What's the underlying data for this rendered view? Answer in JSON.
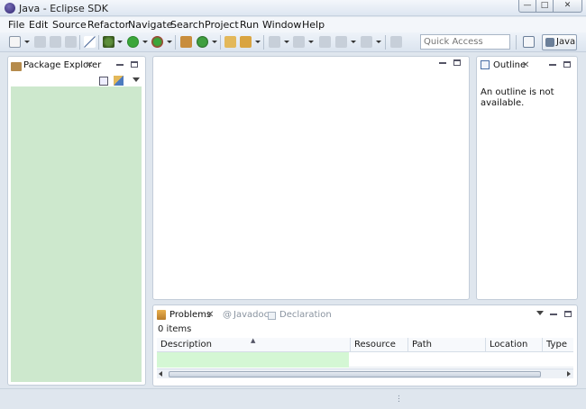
{
  "window": {
    "title": "Java - Eclipse SDK"
  },
  "menu": [
    "File",
    "Edit",
    "Source",
    "Refactor",
    "Navigate",
    "Search",
    "Project",
    "Run",
    "Window",
    "Help"
  ],
  "toolbar": {
    "quick_access_placeholder": "Quick Access",
    "perspective_label": "Java"
  },
  "package_explorer": {
    "tab_label": "Package Explorer"
  },
  "outline": {
    "tab_label": "Outline",
    "message": "An outline is not available."
  },
  "problems": {
    "tabs": [
      "Problems",
      "Javadoc",
      "Declaration"
    ],
    "count_text": "0 items",
    "columns": [
      "Description",
      "Resource",
      "Path",
      "Location",
      "Type"
    ]
  },
  "colors": {
    "accent_green": "#cde8cd",
    "selection_green": "#d4f7d4"
  }
}
